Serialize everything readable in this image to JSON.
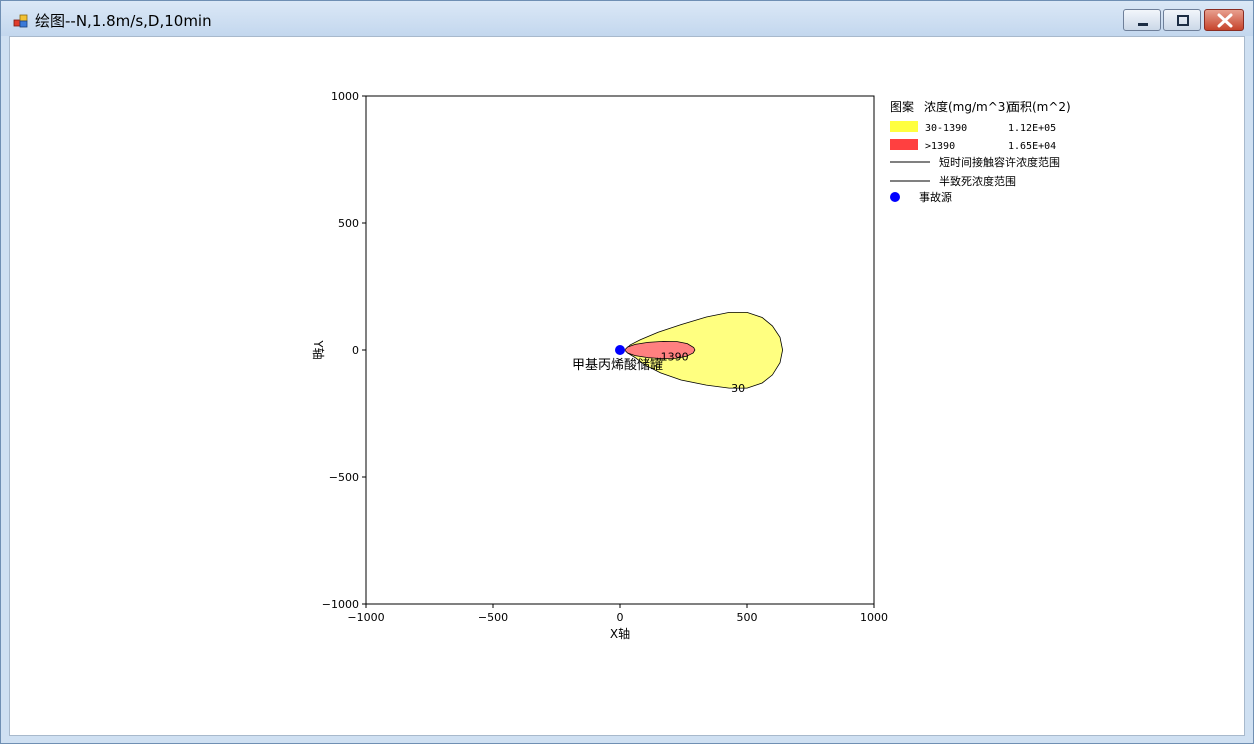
{
  "window": {
    "title": "绘图--N,1.8m/s,D,10min"
  },
  "chart_data": {
    "type": "contour",
    "xlabel": "X轴",
    "ylabel": "Y轴",
    "xlim": [
      -1000,
      1000
    ],
    "ylim": [
      -1000,
      1000
    ],
    "x_ticks": [
      "−1000",
      "−500",
      "0",
      "500",
      "1000"
    ],
    "y_ticks": [
      "1000",
      "500",
      "0",
      "−500",
      "−1000"
    ],
    "source": {
      "x": 0,
      "y": 0,
      "label": "甲基丙烯酸储罐"
    },
    "contours": [
      {
        "level_label": "30",
        "label_at": [
          465,
          -150
        ],
        "color": "#ffff80",
        "outline": [
          [
            20,
            0
          ],
          [
            40,
            20
          ],
          [
            80,
            40
          ],
          [
            150,
            70
          ],
          [
            240,
            100
          ],
          [
            340,
            130
          ],
          [
            430,
            148
          ],
          [
            500,
            148
          ],
          [
            560,
            128
          ],
          [
            600,
            95
          ],
          [
            630,
            50
          ],
          [
            640,
            0
          ],
          [
            630,
            -50
          ],
          [
            600,
            -98
          ],
          [
            560,
            -130
          ],
          [
            500,
            -150
          ],
          [
            430,
            -150
          ],
          [
            340,
            -138
          ],
          [
            240,
            -118
          ],
          [
            160,
            -90
          ],
          [
            100,
            -60
          ],
          [
            60,
            -30
          ],
          [
            30,
            -12
          ],
          [
            20,
            0
          ]
        ]
      },
      {
        "level_label": "1390",
        "label_at": [
          215,
          -25
        ],
        "color": "#ff8080",
        "outline": [
          [
            18,
            0
          ],
          [
            30,
            12
          ],
          [
            60,
            22
          ],
          [
            110,
            30
          ],
          [
            170,
            34
          ],
          [
            225,
            33
          ],
          [
            265,
            25
          ],
          [
            290,
            10
          ],
          [
            295,
            0
          ],
          [
            288,
            -12
          ],
          [
            262,
            -25
          ],
          [
            220,
            -33
          ],
          [
            165,
            -34
          ],
          [
            110,
            -30
          ],
          [
            60,
            -22
          ],
          [
            30,
            -12
          ],
          [
            18,
            0
          ]
        ]
      }
    ],
    "legend": {
      "header": {
        "pattern": "图案",
        "concentration": "浓度(mg/m^3)",
        "area": "面积(m^2)"
      },
      "rows": [
        {
          "color": "#ffff40",
          "range": "30-1390",
          "area": "1.12E+05"
        },
        {
          "color": "#ff4040",
          "range": ">1390",
          "area": "1.65E+04"
        }
      ],
      "lines": [
        {
          "label": "短时间接触容许浓度范围"
        },
        {
          "label": "半致死浓度范围"
        }
      ],
      "point": {
        "color": "#0000ff",
        "label": "事故源"
      }
    }
  }
}
